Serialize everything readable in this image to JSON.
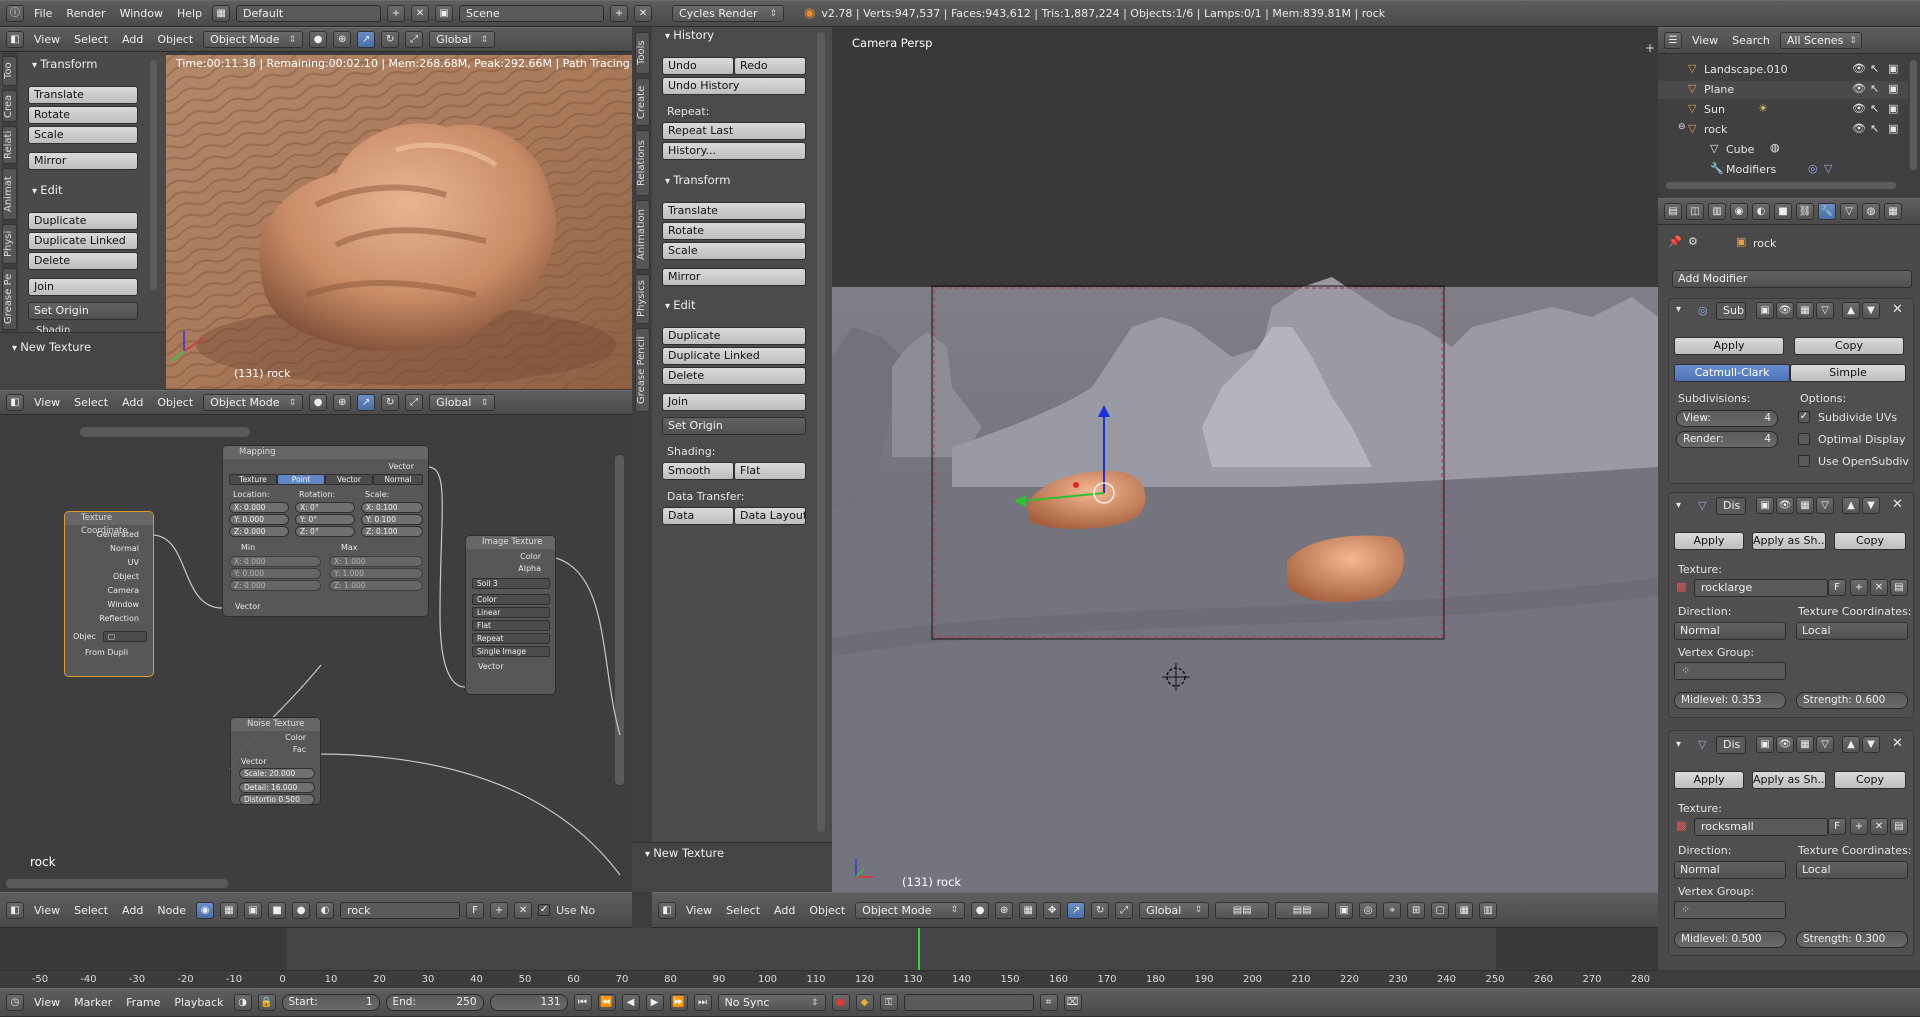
{
  "topbar": {
    "menus": [
      "File",
      "Render",
      "Window",
      "Help"
    ],
    "screen": "Default",
    "scene": "Scene",
    "engine": "Cycles Render",
    "stats": "v2.78 | Verts:947,537 | Faces:943,612 | Tris:1,887,224 | Objects:1/6 | Lamps:0/1 | Mem:839.81M | rock"
  },
  "viewport_menus": [
    "View",
    "Select",
    "Add",
    "Object"
  ],
  "mode": "Object Mode",
  "orientation": "Global",
  "left_tools": {
    "tabs": [
      "Too",
      "Crea",
      "Relati",
      "Animat",
      "Physi",
      "Grease Pe"
    ],
    "transform_title": "Transform",
    "transform": [
      "Translate",
      "Rotate",
      "Scale"
    ],
    "mirror": "Mirror",
    "edit_title": "Edit",
    "edit": [
      "Duplicate",
      "Duplicate Linked",
      "Delete"
    ],
    "join": "Join",
    "set_origin": "Set Origin",
    "cut_label": "Shadin",
    "new_texture": "New Texture"
  },
  "render_view": {
    "status": "Time:00:11.38 | Remaining:00:02.10 | Mem:268.68M, Peak:292.66M | Path Tracing Sampl",
    "object_label": "(131) rock"
  },
  "node_editor": {
    "menus": [
      "View",
      "Select",
      "Add",
      "Node"
    ],
    "material": "rock",
    "material_flag": "F",
    "use_nodes": "Use No",
    "object_label": "rock",
    "texcoord": {
      "title": "Texture Coordinate",
      "outputs": [
        "Generated",
        "Normal",
        "UV",
        "Object",
        "Camera",
        "Window",
        "Reflection"
      ],
      "object_label": "Objec",
      "from_dupli": "From Dupli"
    },
    "mapping": {
      "title": "Mapping",
      "output": "Vector",
      "types": [
        "Texture",
        "Point",
        "Vector",
        "Normal"
      ],
      "headers": [
        "Location:",
        "Rotation:",
        "Scale:"
      ],
      "location": [
        "X:  0.000",
        "Y:  0.000",
        "Z:  0.000"
      ],
      "rotation": [
        "X:    0°",
        "Y:    0°",
        "Z:    0°"
      ],
      "scale": [
        "X:  0.100",
        "Y:  0.100",
        "Z:  0.100"
      ],
      "min": "Min",
      "max": "Max",
      "min_vals": [
        "X:  0.000",
        "Y:  0.000",
        "Z:  0.000"
      ],
      "max_vals": [
        "X:  1.000",
        "Y:  1.000",
        "Z:  1.000"
      ],
      "input": "Vector"
    },
    "image_tex": {
      "title": "Image Texture",
      "outputs": [
        "Color",
        "Alpha"
      ],
      "image": "Soil",
      "users": "3",
      "options": [
        "Color",
        "Linear",
        "Flat",
        "Repeat",
        "Single Image"
      ],
      "input": "Vector"
    },
    "noise_tex": {
      "title": "Noise Texture",
      "outputs": [
        "Color",
        "Fac"
      ],
      "input": "Vector",
      "fields": [
        "Scale: 20.000",
        "Detail: 16.000",
        "Distortio 0.500"
      ]
    }
  },
  "mid_tools": {
    "tabs": [
      "Tools",
      "Create",
      "Relations",
      "Animation",
      "Physics",
      "Grease Pencil"
    ],
    "history_title": "History",
    "undo": "Undo",
    "redo": "Redo",
    "undo_history": "Undo History",
    "repeat_label": "Repeat:",
    "repeat_last": "Repeat Last",
    "history_btn": "History...",
    "transform_title": "Transform",
    "transform": [
      "Translate",
      "Rotate",
      "Scale"
    ],
    "mirror": "Mirror",
    "edit_title": "Edit",
    "edit": [
      "Duplicate",
      "Duplicate Linked",
      "Delete"
    ],
    "join": "Join",
    "set_origin": "Set Origin",
    "shading_label": "Shading:",
    "smooth": "Smooth",
    "flat": "Flat",
    "data_transfer_label": "Data Transfer:",
    "data": "Data",
    "data_layout": "Data Layout",
    "new_texture": "New Texture"
  },
  "viewport3d": {
    "title": "Camera Persp",
    "object_label": "(131) rock"
  },
  "outliner": {
    "menus": [
      "View",
      "Search"
    ],
    "scope": "All Scenes",
    "items": [
      {
        "name": "Landscape.010",
        "indent": 0
      },
      {
        "name": "Plane",
        "indent": 0
      },
      {
        "name": "Sun",
        "indent": 0
      },
      {
        "name": "rock",
        "indent": 0
      },
      {
        "name": "Cube",
        "indent": 1
      },
      {
        "name": "Modifiers",
        "indent": 1
      }
    ]
  },
  "properties": {
    "object": "rock",
    "add_modifier": "Add Modifier",
    "subsurf": {
      "name": "Sub",
      "apply": "Apply",
      "copy": "Copy",
      "catmull": "Catmull-Clark",
      "simple": "Simple",
      "subdivisions_label": "Subdivisions:",
      "options_label": "Options:",
      "view": "View:",
      "view_val": "4",
      "render": "Render:",
      "render_val": "4",
      "subdivide_uvs": "Subdivide UVs",
      "optimal_display": "Optimal Display",
      "use_opensubdiv": "Use OpenSubdiv"
    },
    "displace": [
      {
        "name": "Dis",
        "apply": "Apply",
        "apply_shape": "Apply as Sh...",
        "copy": "Copy",
        "texture_label": "Texture:",
        "texture": "rocklarge",
        "flag": "F",
        "direction_label": "Direction:",
        "direction": "Normal",
        "coords_label": "Texture Coordinates:",
        "coords": "Local",
        "vgroup_label": "Vertex Group:",
        "midlevel": "Midlevel:  0.353",
        "strength": "Strength:  0.600"
      },
      {
        "name": "Dis",
        "apply": "Apply",
        "apply_shape": "Apply as Sh...",
        "copy": "Copy",
        "texture_label": "Texture:",
        "texture": "rocksmall",
        "flag": "F",
        "direction_label": "Direction:",
        "direction": "Normal",
        "coords_label": "Texture Coordinates:",
        "coords": "Local",
        "vgroup_label": "Vertex Group:",
        "midlevel": "Midlevel:  0.500",
        "strength": "Strength:  0.300"
      }
    ]
  },
  "timeline": {
    "ticks": [
      "-50",
      "-40",
      "-30",
      "-20",
      "-10",
      "0",
      "10",
      "20",
      "30",
      "40",
      "50",
      "60",
      "70",
      "80",
      "90",
      "100",
      "110",
      "120",
      "130",
      "140",
      "150",
      "160",
      "170",
      "180",
      "190",
      "200",
      "210",
      "220",
      "230",
      "240",
      "250",
      "260",
      "270",
      "280"
    ],
    "menus": [
      "View",
      "Marker",
      "Frame",
      "Playback"
    ],
    "start": "Start:",
    "start_val": "1",
    "end": "End:",
    "end_val": "250",
    "current": "131",
    "sync": "No Sync",
    "current_frame": 131
  }
}
